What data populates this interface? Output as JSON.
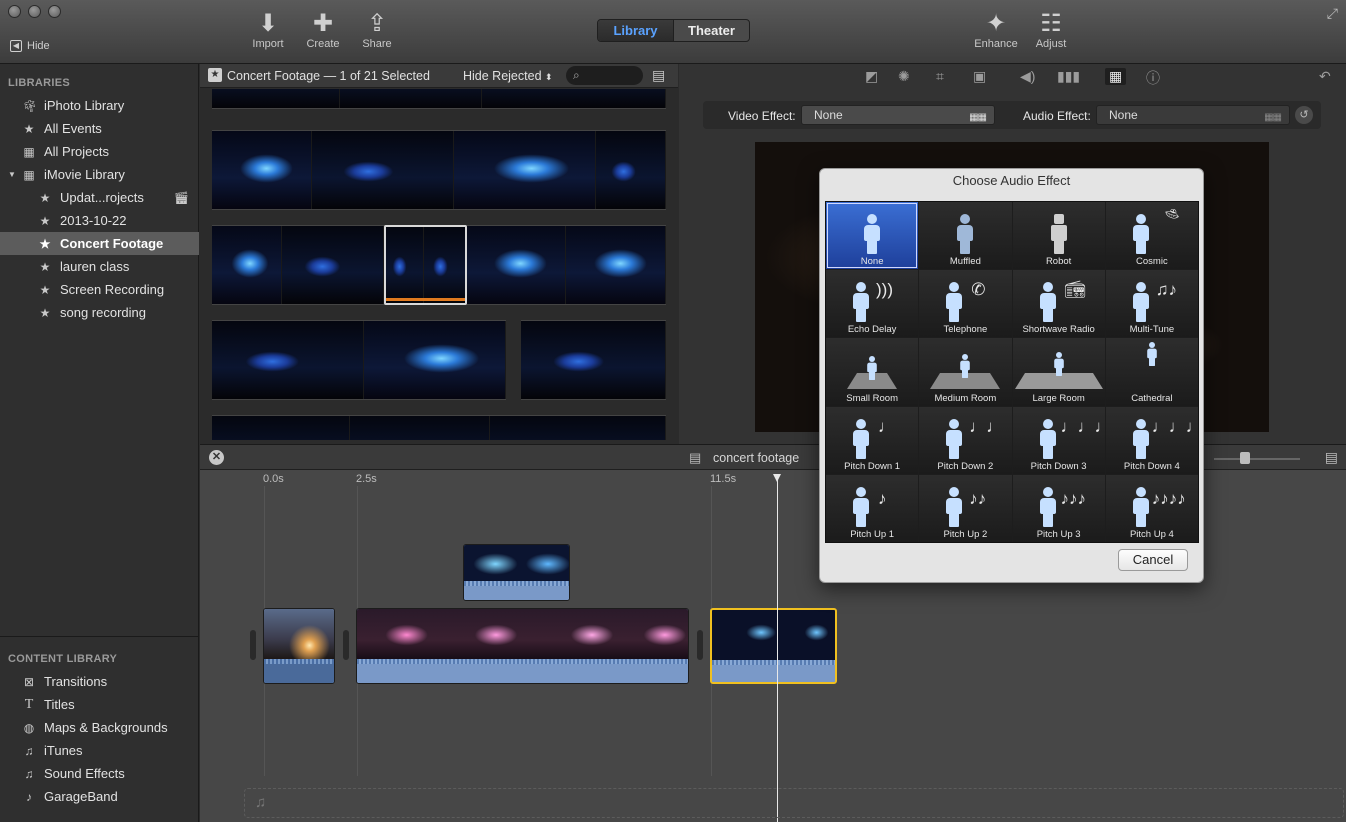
{
  "toolbar": {
    "hide_label": "Hide",
    "import_label": "Import",
    "create_label": "Create",
    "share_label": "Share",
    "library_tab": "Library",
    "theater_tab": "Theater",
    "enhance_label": "Enhance",
    "adjust_label": "Adjust"
  },
  "sidebar": {
    "libraries_heading": "LIBRARIES",
    "libraries": [
      {
        "label": "iPhoto Library",
        "icon": "palm-tree-icon"
      },
      {
        "label": "All Events",
        "icon": "star-icon"
      },
      {
        "label": "All Projects",
        "icon": "grid-icon"
      },
      {
        "label": "iMovie Library",
        "icon": "grid-icon"
      },
      {
        "label": "Updat...rojects",
        "icon": "star-icon"
      },
      {
        "label": "2013-10-22",
        "icon": "star-icon"
      },
      {
        "label": "Concert Footage",
        "icon": "star-icon",
        "selected": true
      },
      {
        "label": "lauren class",
        "icon": "star-icon"
      },
      {
        "label": "Screen Recording",
        "icon": "star-icon"
      },
      {
        "label": "song recording",
        "icon": "star-icon"
      }
    ],
    "content_heading": "CONTENT LIBRARY",
    "content": [
      {
        "label": "Transitions",
        "icon": "transitions-icon"
      },
      {
        "label": "Titles",
        "icon": "titles-icon"
      },
      {
        "label": "Maps & Backgrounds",
        "icon": "globe-icon"
      },
      {
        "label": "iTunes",
        "icon": "music-note-icon"
      },
      {
        "label": "Sound Effects",
        "icon": "music-note-icon"
      },
      {
        "label": "GarageBand",
        "icon": "guitar-icon"
      }
    ]
  },
  "browser": {
    "title": "Concert Footage — 1 of 21 Selected",
    "filter": "Hide Rejected"
  },
  "viewer": {
    "video_effect_label": "Video Effect:",
    "video_effect_value": "None",
    "audio_effect_label": "Audio Effect:",
    "audio_effect_value": "None"
  },
  "timeline": {
    "title": "concert footage",
    "ticks": [
      "0.0s",
      "2.5s",
      "11.5s"
    ]
  },
  "audio_effect_dialog": {
    "title": "Choose Audio Effect",
    "cancel_label": "Cancel",
    "effects": [
      "None",
      "Muffled",
      "Robot",
      "Cosmic",
      "Echo Delay",
      "Telephone",
      "Shortwave Radio",
      "Multi-Tune",
      "Small Room",
      "Medium Room",
      "Large Room",
      "Cathedral",
      "Pitch Down 1",
      "Pitch Down 2",
      "Pitch Down 3",
      "Pitch Down 4",
      "Pitch Up 1",
      "Pitch Up 2",
      "Pitch Up 3",
      "Pitch Up 4"
    ],
    "selected": "None"
  },
  "colors": {
    "accent_blue": "#5aa2ff",
    "selection_orange": "#e07a1f",
    "clip_yellow": "#f0c020"
  }
}
